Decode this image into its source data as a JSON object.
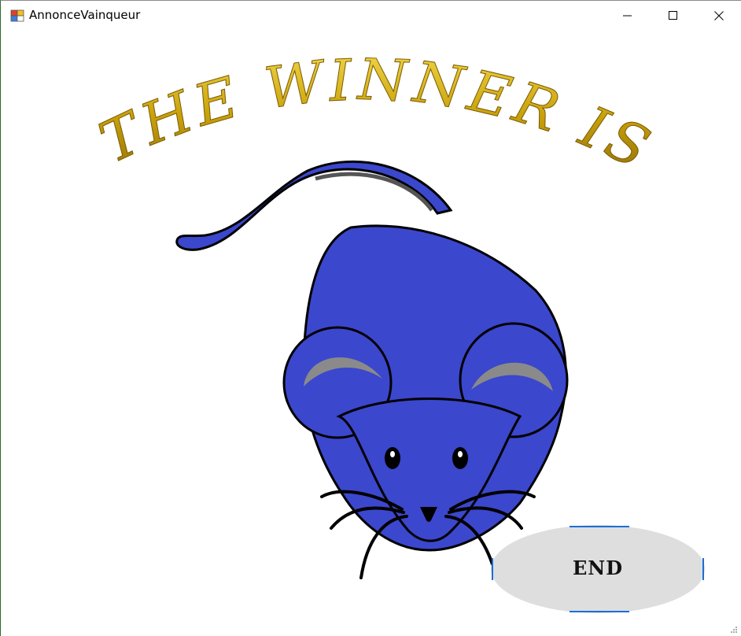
{
  "window": {
    "title": "AnnonceVainqueur",
    "icon": "winforms-app-icon",
    "controls": [
      "minimize-icon",
      "maximize-icon",
      "close-icon"
    ]
  },
  "banner": {
    "text": "THE WINNER IS",
    "color": "#c9a20a"
  },
  "winner": {
    "image": "blue-mouse",
    "body_color": "#3b47cc",
    "ear_color": "#8a8a8a"
  },
  "end_button": {
    "label": "END",
    "background": "#dedede",
    "focus_color": "#1a6fd6"
  }
}
